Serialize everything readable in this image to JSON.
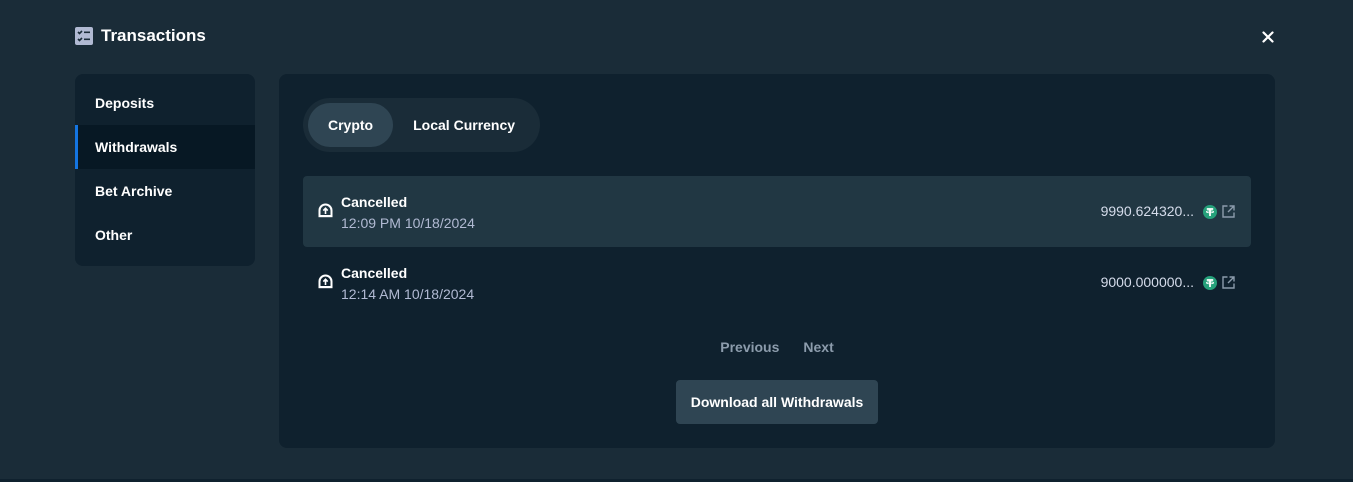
{
  "header": {
    "title": "Transactions",
    "icon": "checklist-icon",
    "close_icon": "close-icon"
  },
  "sidebar": {
    "items": [
      {
        "label": "Deposits",
        "active": false
      },
      {
        "label": "Withdrawals",
        "active": true
      },
      {
        "label": "Bet Archive",
        "active": false
      },
      {
        "label": "Other",
        "active": false
      }
    ]
  },
  "tabs": [
    {
      "label": "Crypto",
      "active": true
    },
    {
      "label": "Local Currency",
      "active": false
    }
  ],
  "transactions": [
    {
      "status": "Cancelled",
      "time": "12:09 PM 10/18/2024",
      "amount": "9990.624320...",
      "coin_icon": "tether-icon",
      "link_icon": "external-link-icon"
    },
    {
      "status": "Cancelled",
      "time": "12:14 AM 10/18/2024",
      "amount": "9000.000000...",
      "coin_icon": "tether-icon",
      "link_icon": "external-link-icon"
    }
  ],
  "pagination": {
    "previous": "Previous",
    "next": "Next"
  },
  "download_button": "Download all Withdrawals",
  "colors": {
    "background": "#1a2c38",
    "panel": "#0f212e",
    "accent": "#1475e1",
    "tether": "#26a17b"
  }
}
